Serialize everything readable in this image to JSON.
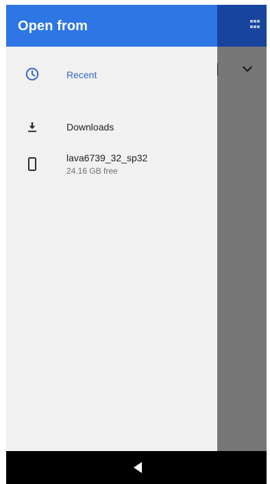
{
  "drawer": {
    "title": "Open from",
    "items": [
      {
        "label": "Recent",
        "icon": "clock-icon",
        "selected": true
      },
      {
        "label": "Downloads",
        "icon": "download-icon"
      },
      {
        "label": "lava6739_32_sp32",
        "sublabel": "24.16 GB free",
        "icon": "phone-icon"
      }
    ]
  },
  "background_app": {
    "icons": [
      "grid-icon",
      "chevron-down-icon"
    ]
  },
  "navbar": {
    "icons": [
      "back-icon"
    ]
  },
  "colors": {
    "drawer_header": "#2d76e3",
    "background_appbar": "#17449c",
    "selected_accent": "#3366c9",
    "scrim": "#777777",
    "drawer_bg": "#f1f1f1"
  }
}
